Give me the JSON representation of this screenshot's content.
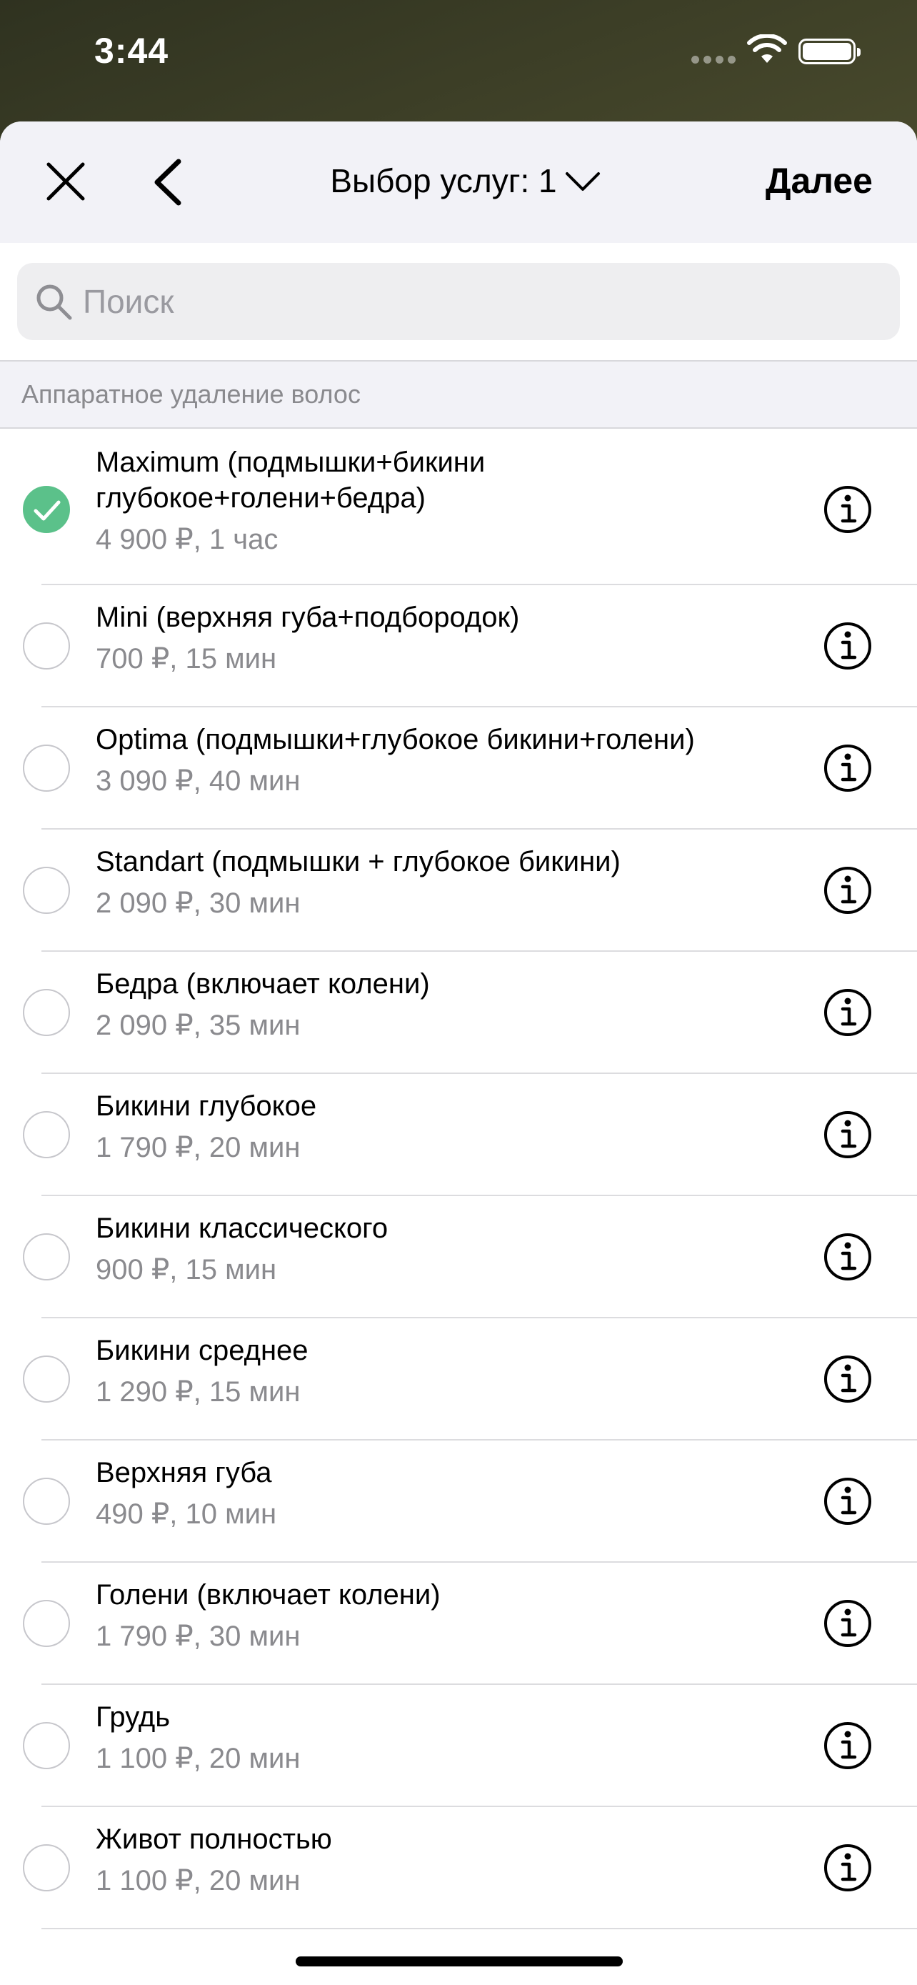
{
  "status_bar": {
    "time": "3:44"
  },
  "nav": {
    "title": "Выбор услуг: 1",
    "next_label": "Далее"
  },
  "search": {
    "placeholder": "Поиск",
    "value": ""
  },
  "section": {
    "title": "Аппаратное удаление волос"
  },
  "services": [
    {
      "name": "Maximum (подмышки+бикини глубокое+голени+бедра)",
      "meta": "4 900 ₽, 1 час",
      "selected": true
    },
    {
      "name": "Mini (верхняя губа+подбородок)",
      "meta": "700 ₽,  15 мин",
      "selected": false
    },
    {
      "name": "Optima (подмышки+глубокое бикини+голени)",
      "meta": "3 090 ₽,  40 мин",
      "selected": false
    },
    {
      "name": "Standart (подмышки + глубокое бикини)",
      "meta": "2 090 ₽,  30 мин",
      "selected": false
    },
    {
      "name": "Бедра (включает колени)",
      "meta": "2 090 ₽,  35 мин",
      "selected": false
    },
    {
      "name": "Бикини глубокое",
      "meta": "1 790 ₽,  20 мин",
      "selected": false
    },
    {
      "name": "Бикини классического",
      "meta": "900 ₽,  15 мин",
      "selected": false
    },
    {
      "name": "Бикини среднее",
      "meta": "1 290 ₽,  15 мин",
      "selected": false
    },
    {
      "name": "Верхняя губа",
      "meta": "490 ₽,  10 мин",
      "selected": false
    },
    {
      "name": "Голени (включает колени)",
      "meta": "1 790 ₽,  30 мин",
      "selected": false
    },
    {
      "name": "Грудь",
      "meta": "1 100 ₽,  20 мин",
      "selected": false
    },
    {
      "name": "Живот полностью",
      "meta": "1 100 ₽,  20 мин",
      "selected": false
    }
  ],
  "colors": {
    "accent_green": "#5bc18a",
    "secondary_text": "#8a8a8e",
    "nav_background": "#f2f2f7"
  },
  "icons": [
    "close-icon",
    "chevron-left-icon",
    "chevron-down-icon",
    "search-icon",
    "checkmark-icon",
    "info-icon",
    "wifi-icon",
    "battery-icon"
  ]
}
